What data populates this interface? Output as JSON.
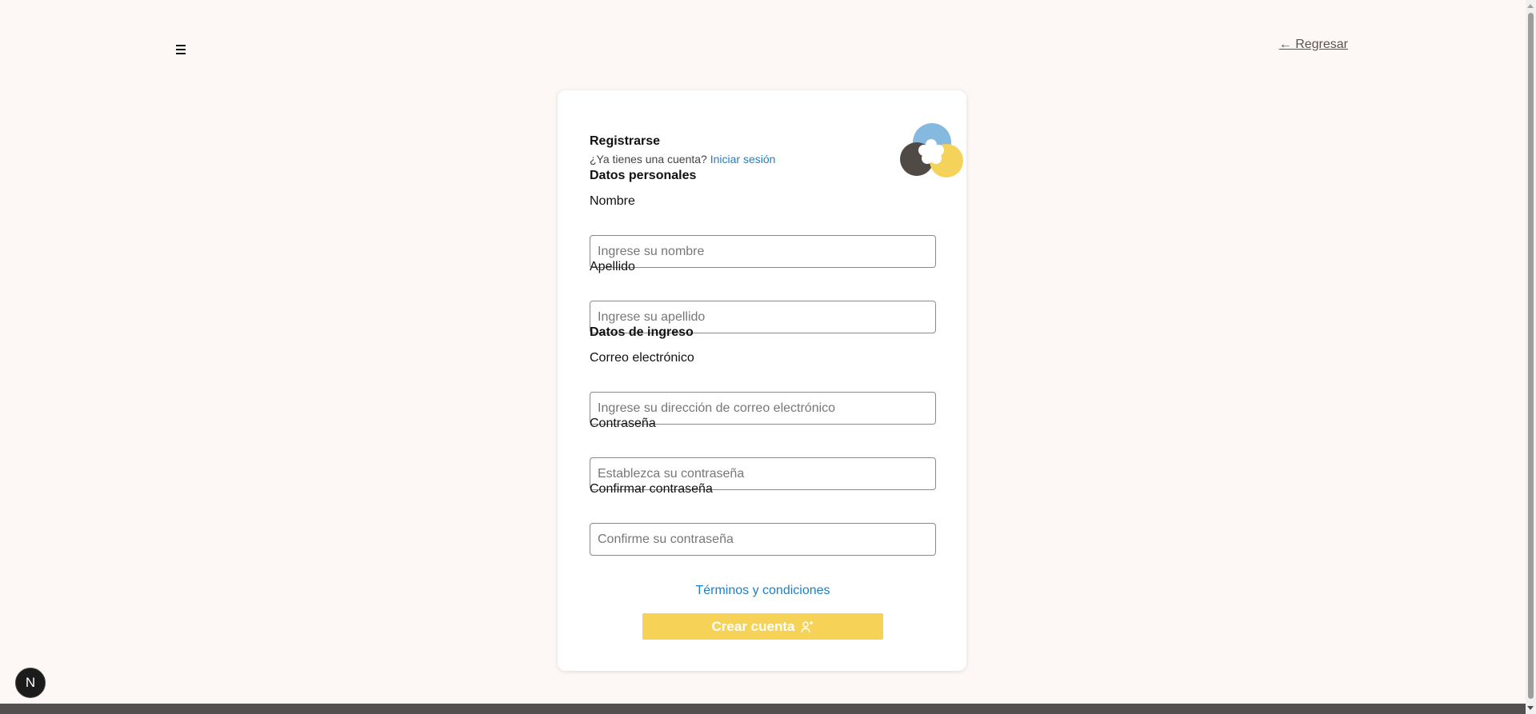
{
  "header": {
    "menu_icon": "hamburger-menu-icon",
    "back_label": "← Regresar"
  },
  "form": {
    "title": "Registrarse",
    "subtitle_text": "¿Ya tienes una cuenta?",
    "login_link": "Iniciar sesión",
    "logo_icon": "flower-circles-logo",
    "sections": {
      "personal": "Datos personales",
      "login": "Datos de ingreso"
    },
    "fields": {
      "nombre": {
        "label": "Nombre",
        "placeholder": "Ingrese su nombre",
        "value": ""
      },
      "apellido": {
        "label": "Apellido",
        "placeholder": "Ingrese su apellido",
        "value": ""
      },
      "correo": {
        "label": "Correo electrónico",
        "placeholder": "Ingrese su dirección de correo electrónico",
        "value": ""
      },
      "contrasena": {
        "label": "Contraseña",
        "placeholder": "Establezca su contraseña",
        "value": ""
      },
      "confirmar": {
        "label": "Confirmar contraseña",
        "placeholder": "Confirme su contraseña",
        "value": ""
      }
    },
    "terms_link": "Términos y condiciones",
    "submit_label": "Crear cuenta",
    "submit_icon": "user-plus-icon"
  },
  "badge": {
    "label": "N"
  },
  "colors": {
    "background": "#fdf8f6",
    "link": "#1f7fc4",
    "button": "#f6d257",
    "logo_blue": "#86b9e0",
    "logo_dark": "#4f4a45",
    "logo_yellow": "#f5d35b"
  }
}
